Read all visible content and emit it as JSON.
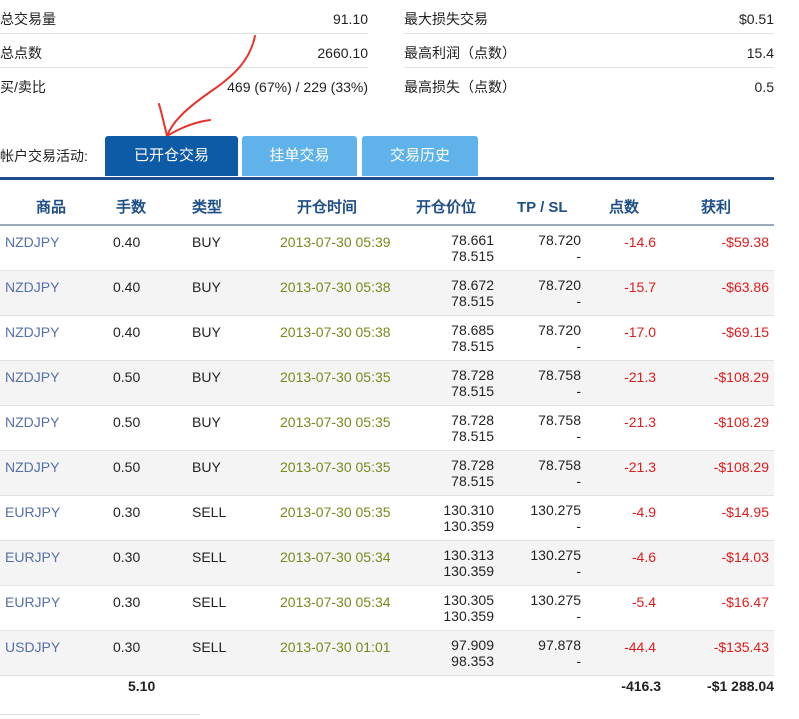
{
  "stats": {
    "left": [
      {
        "label": "总交易量",
        "value": "91.10"
      },
      {
        "label": "总点数",
        "value": "2660.10"
      },
      {
        "label": "买/卖比",
        "value": "469 (67%) / 229 (33%)"
      }
    ],
    "right": [
      {
        "label": "最大损失交易",
        "value": "$0.51"
      },
      {
        "label": "最高利润（点数）",
        "value": "15.4"
      },
      {
        "label": "最高损失（点数）",
        "value": "0.5"
      }
    ]
  },
  "tabs": {
    "label": "帐户交易活动:",
    "items": [
      "已开仓交易",
      "挂单交易",
      "交易历史"
    ]
  },
  "annotation": {
    "color": "#e8322a"
  },
  "table": {
    "headers": [
      "商品",
      "手数",
      "类型",
      "开仓时间",
      "开仓价位",
      "TP / SL",
      "点数",
      "获利"
    ],
    "rows": [
      {
        "symbol": "NZDJPY",
        "lots": "0.40",
        "type": "BUY",
        "time": "2013-07-30 05:39",
        "price1": "78.661",
        "price2": "78.515",
        "tp": "78.720",
        "sl": "-",
        "points": "-14.6",
        "profit": "-$59.38"
      },
      {
        "symbol": "NZDJPY",
        "lots": "0.40",
        "type": "BUY",
        "time": "2013-07-30 05:38",
        "price1": "78.672",
        "price2": "78.515",
        "tp": "78.720",
        "sl": "-",
        "points": "-15.7",
        "profit": "-$63.86"
      },
      {
        "symbol": "NZDJPY",
        "lots": "0.40",
        "type": "BUY",
        "time": "2013-07-30 05:38",
        "price1": "78.685",
        "price2": "78.515",
        "tp": "78.720",
        "sl": "-",
        "points": "-17.0",
        "profit": "-$69.15"
      },
      {
        "symbol": "NZDJPY",
        "lots": "0.50",
        "type": "BUY",
        "time": "2013-07-30 05:35",
        "price1": "78.728",
        "price2": "78.515",
        "tp": "78.758",
        "sl": "-",
        "points": "-21.3",
        "profit": "-$108.29"
      },
      {
        "symbol": "NZDJPY",
        "lots": "0.50",
        "type": "BUY",
        "time": "2013-07-30 05:35",
        "price1": "78.728",
        "price2": "78.515",
        "tp": "78.758",
        "sl": "-",
        "points": "-21.3",
        "profit": "-$108.29"
      },
      {
        "symbol": "NZDJPY",
        "lots": "0.50",
        "type": "BUY",
        "time": "2013-07-30 05:35",
        "price1": "78.728",
        "price2": "78.515",
        "tp": "78.758",
        "sl": "-",
        "points": "-21.3",
        "profit": "-$108.29"
      },
      {
        "symbol": "EURJPY",
        "lots": "0.30",
        "type": "SELL",
        "time": "2013-07-30 05:35",
        "price1": "130.310",
        "price2": "130.359",
        "tp": "130.275",
        "sl": "-",
        "points": "-4.9",
        "profit": "-$14.95"
      },
      {
        "symbol": "EURJPY",
        "lots": "0.30",
        "type": "SELL",
        "time": "2013-07-30 05:34",
        "price1": "130.313",
        "price2": "130.359",
        "tp": "130.275",
        "sl": "-",
        "points": "-4.6",
        "profit": "-$14.03"
      },
      {
        "symbol": "EURJPY",
        "lots": "0.30",
        "type": "SELL",
        "time": "2013-07-30 05:34",
        "price1": "130.305",
        "price2": "130.359",
        "tp": "130.275",
        "sl": "-",
        "points": "-5.4",
        "profit": "-$16.47"
      },
      {
        "symbol": "USDJPY",
        "lots": "0.30",
        "type": "SELL",
        "time": "2013-07-30 01:01",
        "price1": "97.909",
        "price2": "98.353",
        "tp": "97.878",
        "sl": "-",
        "points": "-44.4",
        "profit": "-$135.43"
      }
    ],
    "totals": {
      "lots": "5.10",
      "points": "-416.3",
      "profit": "-$1 288.04"
    }
  }
}
